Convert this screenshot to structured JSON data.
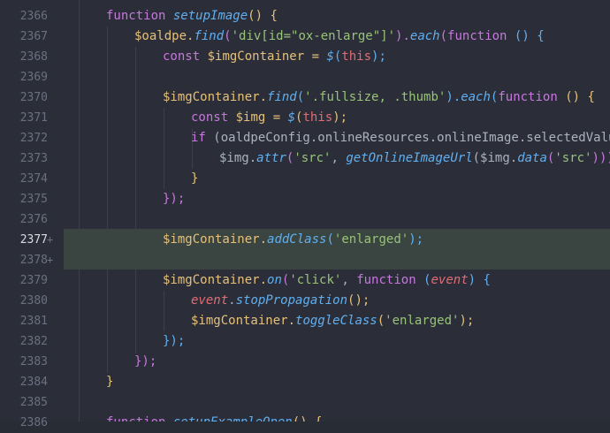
{
  "editor": {
    "line_numbers": [
      "2366",
      "2367",
      "2368",
      "2369",
      "2370",
      "2371",
      "2372",
      "2373",
      "2374",
      "2375",
      "2376",
      "2377",
      "2378",
      "2379",
      "2380",
      "2381",
      "2382",
      "2383",
      "2384",
      "2385",
      "2386"
    ],
    "modified_marker": "+",
    "current_line": "2377",
    "colors": {
      "background": "#2b2e38",
      "highlight": "#3a4541",
      "keyword": "#c678dd",
      "function": "#61afef",
      "string": "#98c379",
      "variable": "#e5c07b",
      "this": "#e06c75"
    }
  },
  "code": {
    "l2366": {
      "kw": "function",
      "name": "setupImage",
      "rest": "() {"
    },
    "l2367": {
      "obj": "$oaldpe.",
      "fn": "find",
      "p1": "(",
      "s": "'div[id=\"ox-enlarge\"]'",
      "p2": ").",
      "fn2": "each",
      "p3": "(",
      "kw": "function",
      "rest": " () {"
    },
    "l2368": {
      "kw": "const",
      "v": " $imgContainer = ",
      "fn": "$",
      "p1": "(",
      "th": "this",
      "p2": ");"
    },
    "l2370": {
      "obj": "$imgContainer.",
      "fn": "find",
      "p1": "(",
      "s": "'.fullsize, .thumb'",
      "p2": ").",
      "fn2": "each",
      "p3": "(",
      "kw": "function",
      "rest": " () {"
    },
    "l2371": {
      "kw": "const",
      "v": " $img = ",
      "fn": "$",
      "p1": "(",
      "th": "this",
      "p2": ");"
    },
    "l2372": {
      "kw": "if",
      "rest": " (oaldpeConfig.onlineResources.onlineImage.selectedValue ="
    },
    "l2373": {
      "obj": "$img.",
      "fn": "attr",
      "p1": "(",
      "s": "'src'",
      "c": ", ",
      "fn2": "getOnlineImageUrl",
      "p2": "($img.",
      "fn3": "data",
      "p3": "(",
      "s2": "'src'",
      "p4": ")));"
    },
    "l2374": {
      "b": "}"
    },
    "l2375": {
      "b": "});"
    },
    "l2377": {
      "obj": "$imgContainer.",
      "fn": "addClass",
      "p1": "(",
      "s": "'enlarged'",
      "p2": ");"
    },
    "l2379": {
      "obj": "$imgContainer.",
      "fn": "on",
      "p1": "(",
      "s": "'click'",
      "c": ", ",
      "kw": "function",
      "p2": " (",
      "par": "event",
      "rest": ") {"
    },
    "l2380": {
      "par": "event",
      "dot": ".",
      "fn": "stopPropagation",
      "rest": "();"
    },
    "l2381": {
      "obj": "$imgContainer.",
      "fn": "toggleClass",
      "p1": "(",
      "s": "'enlarged'",
      "p2": ");"
    },
    "l2382": {
      "b": "});"
    },
    "l2383": {
      "b": "});"
    },
    "l2384": {
      "b": "}"
    },
    "l2386": {
      "kw": "function",
      "name": "setupExampleOpen",
      "rest": "() {"
    }
  }
}
